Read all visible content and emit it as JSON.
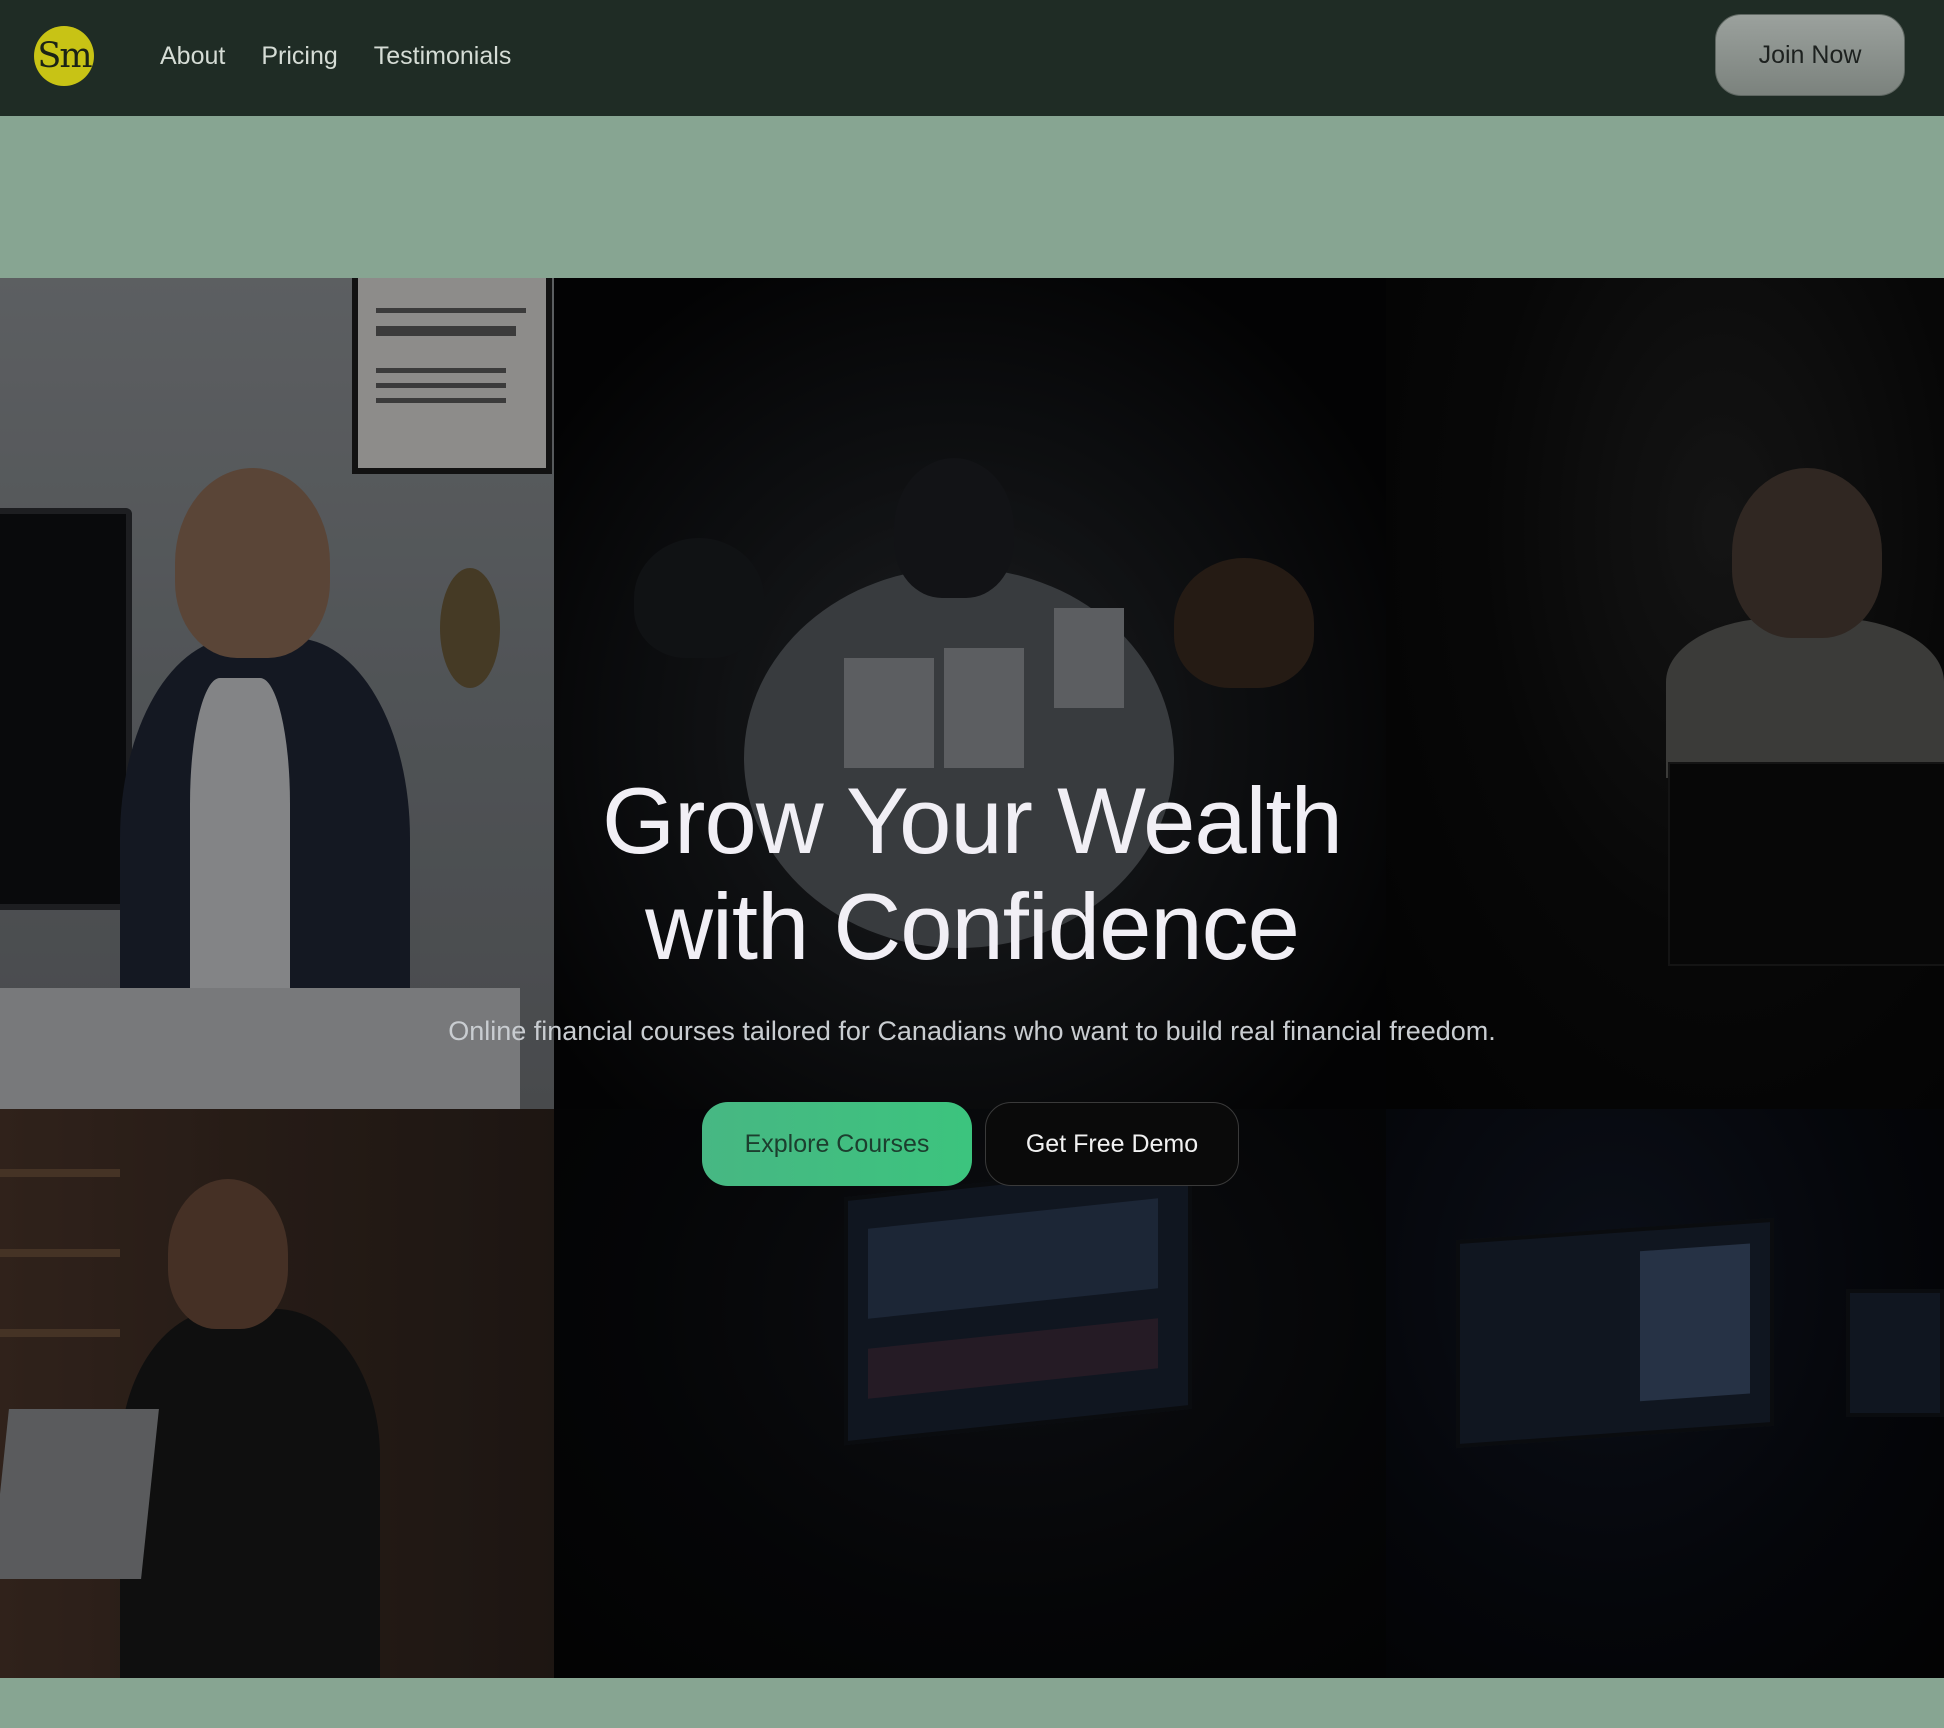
{
  "nav": {
    "logo_text": "Sm",
    "links": [
      "About",
      "Pricing",
      "Testimonials"
    ],
    "cta": "Join Now"
  },
  "hero": {
    "title_line1": "Grow Your Wealth",
    "title_line2": "with Confidence",
    "subtitle": "Online financial courses tailored for Canadians who want to build real financial freedom.",
    "primary_button": "Explore Courses",
    "secondary_button": "Get Free Demo"
  },
  "colors": {
    "nav_bg": "#1f2c25",
    "page_bg": "#87a592",
    "logo_bg": "#c8c315",
    "primary_accent": "#3cc47e"
  }
}
